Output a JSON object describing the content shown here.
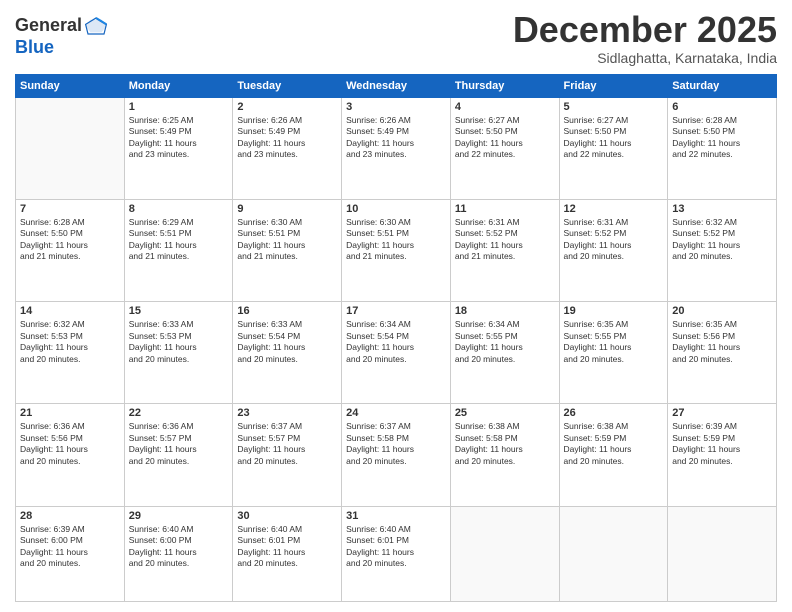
{
  "header": {
    "logo_general": "General",
    "logo_blue": "Blue",
    "month_title": "December 2025",
    "location": "Sidlaghatta, Karnataka, India"
  },
  "days_of_week": [
    "Sunday",
    "Monday",
    "Tuesday",
    "Wednesday",
    "Thursday",
    "Friday",
    "Saturday"
  ],
  "weeks": [
    [
      {
        "day": "",
        "info": ""
      },
      {
        "day": "1",
        "info": "Sunrise: 6:25 AM\nSunset: 5:49 PM\nDaylight: 11 hours\nand 23 minutes."
      },
      {
        "day": "2",
        "info": "Sunrise: 6:26 AM\nSunset: 5:49 PM\nDaylight: 11 hours\nand 23 minutes."
      },
      {
        "day": "3",
        "info": "Sunrise: 6:26 AM\nSunset: 5:49 PM\nDaylight: 11 hours\nand 23 minutes."
      },
      {
        "day": "4",
        "info": "Sunrise: 6:27 AM\nSunset: 5:50 PM\nDaylight: 11 hours\nand 22 minutes."
      },
      {
        "day": "5",
        "info": "Sunrise: 6:27 AM\nSunset: 5:50 PM\nDaylight: 11 hours\nand 22 minutes."
      },
      {
        "day": "6",
        "info": "Sunrise: 6:28 AM\nSunset: 5:50 PM\nDaylight: 11 hours\nand 22 minutes."
      }
    ],
    [
      {
        "day": "7",
        "info": "Sunrise: 6:28 AM\nSunset: 5:50 PM\nDaylight: 11 hours\nand 21 minutes."
      },
      {
        "day": "8",
        "info": "Sunrise: 6:29 AM\nSunset: 5:51 PM\nDaylight: 11 hours\nand 21 minutes."
      },
      {
        "day": "9",
        "info": "Sunrise: 6:30 AM\nSunset: 5:51 PM\nDaylight: 11 hours\nand 21 minutes."
      },
      {
        "day": "10",
        "info": "Sunrise: 6:30 AM\nSunset: 5:51 PM\nDaylight: 11 hours\nand 21 minutes."
      },
      {
        "day": "11",
        "info": "Sunrise: 6:31 AM\nSunset: 5:52 PM\nDaylight: 11 hours\nand 21 minutes."
      },
      {
        "day": "12",
        "info": "Sunrise: 6:31 AM\nSunset: 5:52 PM\nDaylight: 11 hours\nand 20 minutes."
      },
      {
        "day": "13",
        "info": "Sunrise: 6:32 AM\nSunset: 5:52 PM\nDaylight: 11 hours\nand 20 minutes."
      }
    ],
    [
      {
        "day": "14",
        "info": "Sunrise: 6:32 AM\nSunset: 5:53 PM\nDaylight: 11 hours\nand 20 minutes."
      },
      {
        "day": "15",
        "info": "Sunrise: 6:33 AM\nSunset: 5:53 PM\nDaylight: 11 hours\nand 20 minutes."
      },
      {
        "day": "16",
        "info": "Sunrise: 6:33 AM\nSunset: 5:54 PM\nDaylight: 11 hours\nand 20 minutes."
      },
      {
        "day": "17",
        "info": "Sunrise: 6:34 AM\nSunset: 5:54 PM\nDaylight: 11 hours\nand 20 minutes."
      },
      {
        "day": "18",
        "info": "Sunrise: 6:34 AM\nSunset: 5:55 PM\nDaylight: 11 hours\nand 20 minutes."
      },
      {
        "day": "19",
        "info": "Sunrise: 6:35 AM\nSunset: 5:55 PM\nDaylight: 11 hours\nand 20 minutes."
      },
      {
        "day": "20",
        "info": "Sunrise: 6:35 AM\nSunset: 5:56 PM\nDaylight: 11 hours\nand 20 minutes."
      }
    ],
    [
      {
        "day": "21",
        "info": "Sunrise: 6:36 AM\nSunset: 5:56 PM\nDaylight: 11 hours\nand 20 minutes."
      },
      {
        "day": "22",
        "info": "Sunrise: 6:36 AM\nSunset: 5:57 PM\nDaylight: 11 hours\nand 20 minutes."
      },
      {
        "day": "23",
        "info": "Sunrise: 6:37 AM\nSunset: 5:57 PM\nDaylight: 11 hours\nand 20 minutes."
      },
      {
        "day": "24",
        "info": "Sunrise: 6:37 AM\nSunset: 5:58 PM\nDaylight: 11 hours\nand 20 minutes."
      },
      {
        "day": "25",
        "info": "Sunrise: 6:38 AM\nSunset: 5:58 PM\nDaylight: 11 hours\nand 20 minutes."
      },
      {
        "day": "26",
        "info": "Sunrise: 6:38 AM\nSunset: 5:59 PM\nDaylight: 11 hours\nand 20 minutes."
      },
      {
        "day": "27",
        "info": "Sunrise: 6:39 AM\nSunset: 5:59 PM\nDaylight: 11 hours\nand 20 minutes."
      }
    ],
    [
      {
        "day": "28",
        "info": "Sunrise: 6:39 AM\nSunset: 6:00 PM\nDaylight: 11 hours\nand 20 minutes."
      },
      {
        "day": "29",
        "info": "Sunrise: 6:40 AM\nSunset: 6:00 PM\nDaylight: 11 hours\nand 20 minutes."
      },
      {
        "day": "30",
        "info": "Sunrise: 6:40 AM\nSunset: 6:01 PM\nDaylight: 11 hours\nand 20 minutes."
      },
      {
        "day": "31",
        "info": "Sunrise: 6:40 AM\nSunset: 6:01 PM\nDaylight: 11 hours\nand 20 minutes."
      },
      {
        "day": "",
        "info": ""
      },
      {
        "day": "",
        "info": ""
      },
      {
        "day": "",
        "info": ""
      }
    ]
  ]
}
